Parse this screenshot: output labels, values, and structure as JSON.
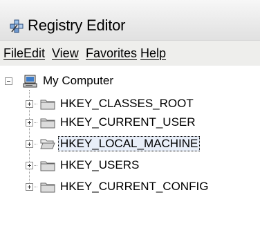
{
  "window": {
    "title": "Registry Editor"
  },
  "menubar": {
    "items": [
      {
        "label": "File"
      },
      {
        "label": "Edit"
      },
      {
        "label": "View"
      },
      {
        "label": "Favorites"
      },
      {
        "label": "Help"
      }
    ]
  },
  "tree": {
    "root": {
      "label": "My Computer",
      "expanded": true
    },
    "children": [
      {
        "label": "HKEY_CLASSES_ROOT",
        "selected": false
      },
      {
        "label": "HKEY_CURRENT_USER",
        "selected": false
      },
      {
        "label": "HKEY_LOCAL_MACHINE",
        "selected": true
      },
      {
        "label": "HKEY_USERS",
        "selected": false
      },
      {
        "label": "HKEY_CURRENT_CONFIG",
        "selected": false
      }
    ]
  }
}
